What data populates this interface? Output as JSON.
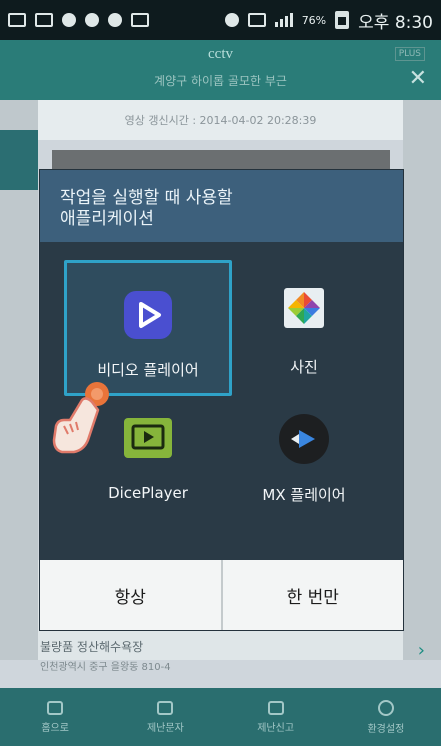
{
  "status_bar": {
    "battery_percent": "76%",
    "time": "오후 8:30"
  },
  "app_header": {
    "title": "cctv",
    "subtitle": "계양구 하이롭 골모한 부근",
    "badge": "PLUS"
  },
  "update_bar": {
    "text": "영상 갱신시간 : 2014-04-02 20:28:39"
  },
  "dialog": {
    "title_line1": "작업을 실행할 때 사용할",
    "title_line2": "애플리케이션",
    "apps": [
      {
        "label": "비디오 플레이어",
        "icon": "video-player-icon",
        "selected": true
      },
      {
        "label": "사진",
        "icon": "photos-icon",
        "selected": false
      },
      {
        "label": "DicePlayer",
        "icon": "diceplayer-icon",
        "selected": false
      },
      {
        "label": "MX 플레이어",
        "icon": "mx-player-icon",
        "selected": false
      }
    ],
    "buttons": {
      "always": "항상",
      "just_once": "한 번만"
    }
  },
  "background_info": {
    "title": "불량품 정산해수욕장",
    "subtitle": "인천광역시 중구 을왕동 810-4"
  },
  "bottom_nav": [
    {
      "label": "홈으로",
      "icon": "home-icon"
    },
    {
      "label": "제난문자",
      "icon": "building-icon"
    },
    {
      "label": "제난신고",
      "icon": "report-icon"
    },
    {
      "label": "환경설정",
      "icon": "settings-icon"
    }
  ],
  "colors": {
    "accent": "#2fa2c8",
    "dialog_header": "#3d607c",
    "dialog_bg": "#2a3a46",
    "app_teal": "#2a7c78"
  }
}
